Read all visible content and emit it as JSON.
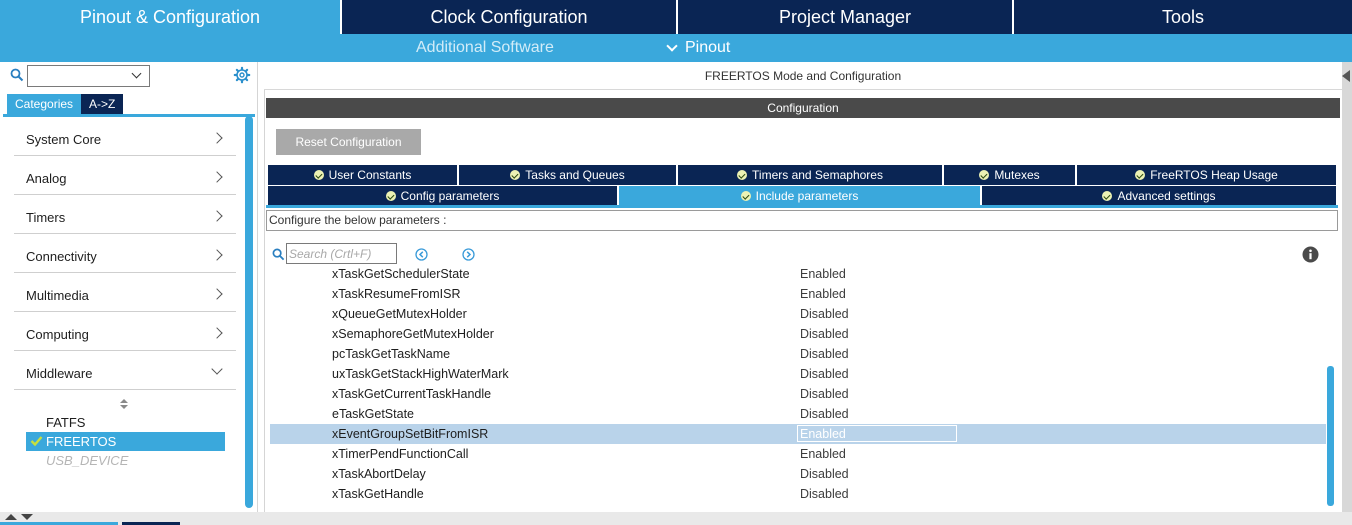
{
  "top_tabs": [
    {
      "label": "Pinout & Configuration",
      "active": true
    },
    {
      "label": "Clock Configuration",
      "active": false
    },
    {
      "label": "Project Manager",
      "active": false
    },
    {
      "label": "Tools",
      "active": false
    }
  ],
  "sub_bar": {
    "additional_software": "Additional Software",
    "pinout": "Pinout"
  },
  "left": {
    "category_select_value": "",
    "seg_tabs": [
      "Categories",
      "A->Z"
    ],
    "categories": [
      {
        "label": "System Core",
        "expanded": false
      },
      {
        "label": "Analog",
        "expanded": false
      },
      {
        "label": "Timers",
        "expanded": false
      },
      {
        "label": "Connectivity",
        "expanded": false
      },
      {
        "label": "Multimedia",
        "expanded": false
      },
      {
        "label": "Computing",
        "expanded": false
      },
      {
        "label": "Middleware",
        "expanded": true
      }
    ],
    "middleware_items": [
      {
        "label": "FATFS",
        "state": "normal"
      },
      {
        "label": "FREERTOS",
        "state": "selected"
      },
      {
        "label": "USB_DEVICE",
        "state": "disabled"
      }
    ]
  },
  "right": {
    "mode_title": "FREERTOS Mode and Configuration",
    "config_title": "Configuration",
    "reset_label": "Reset Configuration",
    "tabs_row1": [
      "User Constants",
      "Tasks and Queues",
      "Timers and Semaphores",
      "Mutexes",
      "FreeRTOS Heap Usage"
    ],
    "tabs_row2": [
      "Config parameters",
      "Include parameters",
      "Advanced settings"
    ],
    "active_tab": "Include parameters",
    "configure_text": "Configure the below parameters :",
    "search_placeholder": "Search (Crtl+F)",
    "parameters": [
      {
        "name": "xTaskGetSchedulerState",
        "value": "Enabled"
      },
      {
        "name": "xTaskResumeFromISR",
        "value": "Enabled"
      },
      {
        "name": "xQueueGetMutexHolder",
        "value": "Disabled"
      },
      {
        "name": "xSemaphoreGetMutexHolder",
        "value": "Disabled"
      },
      {
        "name": "pcTaskGetTaskName",
        "value": "Disabled"
      },
      {
        "name": "uxTaskGetStackHighWaterMark",
        "value": "Disabled"
      },
      {
        "name": "xTaskGetCurrentTaskHandle",
        "value": "Disabled"
      },
      {
        "name": "eTaskGetState",
        "value": "Disabled"
      },
      {
        "name": "xEventGroupSetBitFromISR",
        "value": "Enabled",
        "selected": true
      },
      {
        "name": "xTimerPendFunctionCall",
        "value": "Enabled"
      },
      {
        "name": "xTaskAbortDelay",
        "value": "Disabled"
      },
      {
        "name": "xTaskGetHandle",
        "value": "Disabled"
      }
    ]
  },
  "colors": {
    "navy": "#0a2554",
    "accent": "#3aa8dc",
    "config_bar": "#4a4a4a",
    "selected_row": "#b9d3ea"
  },
  "icons": [
    "search-icon",
    "gear-icon",
    "chevron-right-icon",
    "chevron-down-icon",
    "check-icon",
    "info-icon",
    "circle-chevron-left-icon",
    "circle-chevron-right-icon",
    "sort-icon"
  ]
}
